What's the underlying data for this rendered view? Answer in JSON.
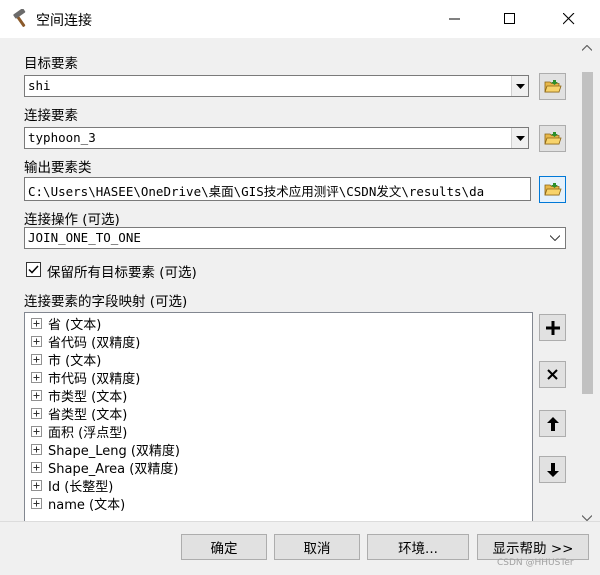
{
  "window": {
    "title": "空间连接",
    "icon": "hammer-icon"
  },
  "fields": {
    "target_label": "目标要素",
    "target_value": "shi",
    "join_label": "连接要素",
    "join_value": "typhoon_3",
    "output_label": "输出要素类",
    "output_value": "C:\\Users\\HASEE\\OneDrive\\桌面\\GIS技术应用测评\\CSDN发文\\results\\da",
    "operation_label": "连接操作 (可选)",
    "operation_value": "JOIN_ONE_TO_ONE"
  },
  "keep_all": {
    "label": "保留所有目标要素 (可选)",
    "checked": true
  },
  "field_map": {
    "label": "连接要素的字段映射 (可选)",
    "items": [
      "省 (文本)",
      "省代码 (双精度)",
      "市 (文本)",
      "市代码 (双精度)",
      "市类型 (文本)",
      "省类型 (文本)",
      "面积 (浮点型)",
      "Shape_Leng (双精度)",
      "Shape_Area (双精度)",
      "Id (长整型)",
      "name (文本)"
    ]
  },
  "buttons": {
    "ok": "确定",
    "cancel": "取消",
    "env": "环境...",
    "help": "显示帮助 >>"
  },
  "watermark": "CSDN @HHUSTer"
}
